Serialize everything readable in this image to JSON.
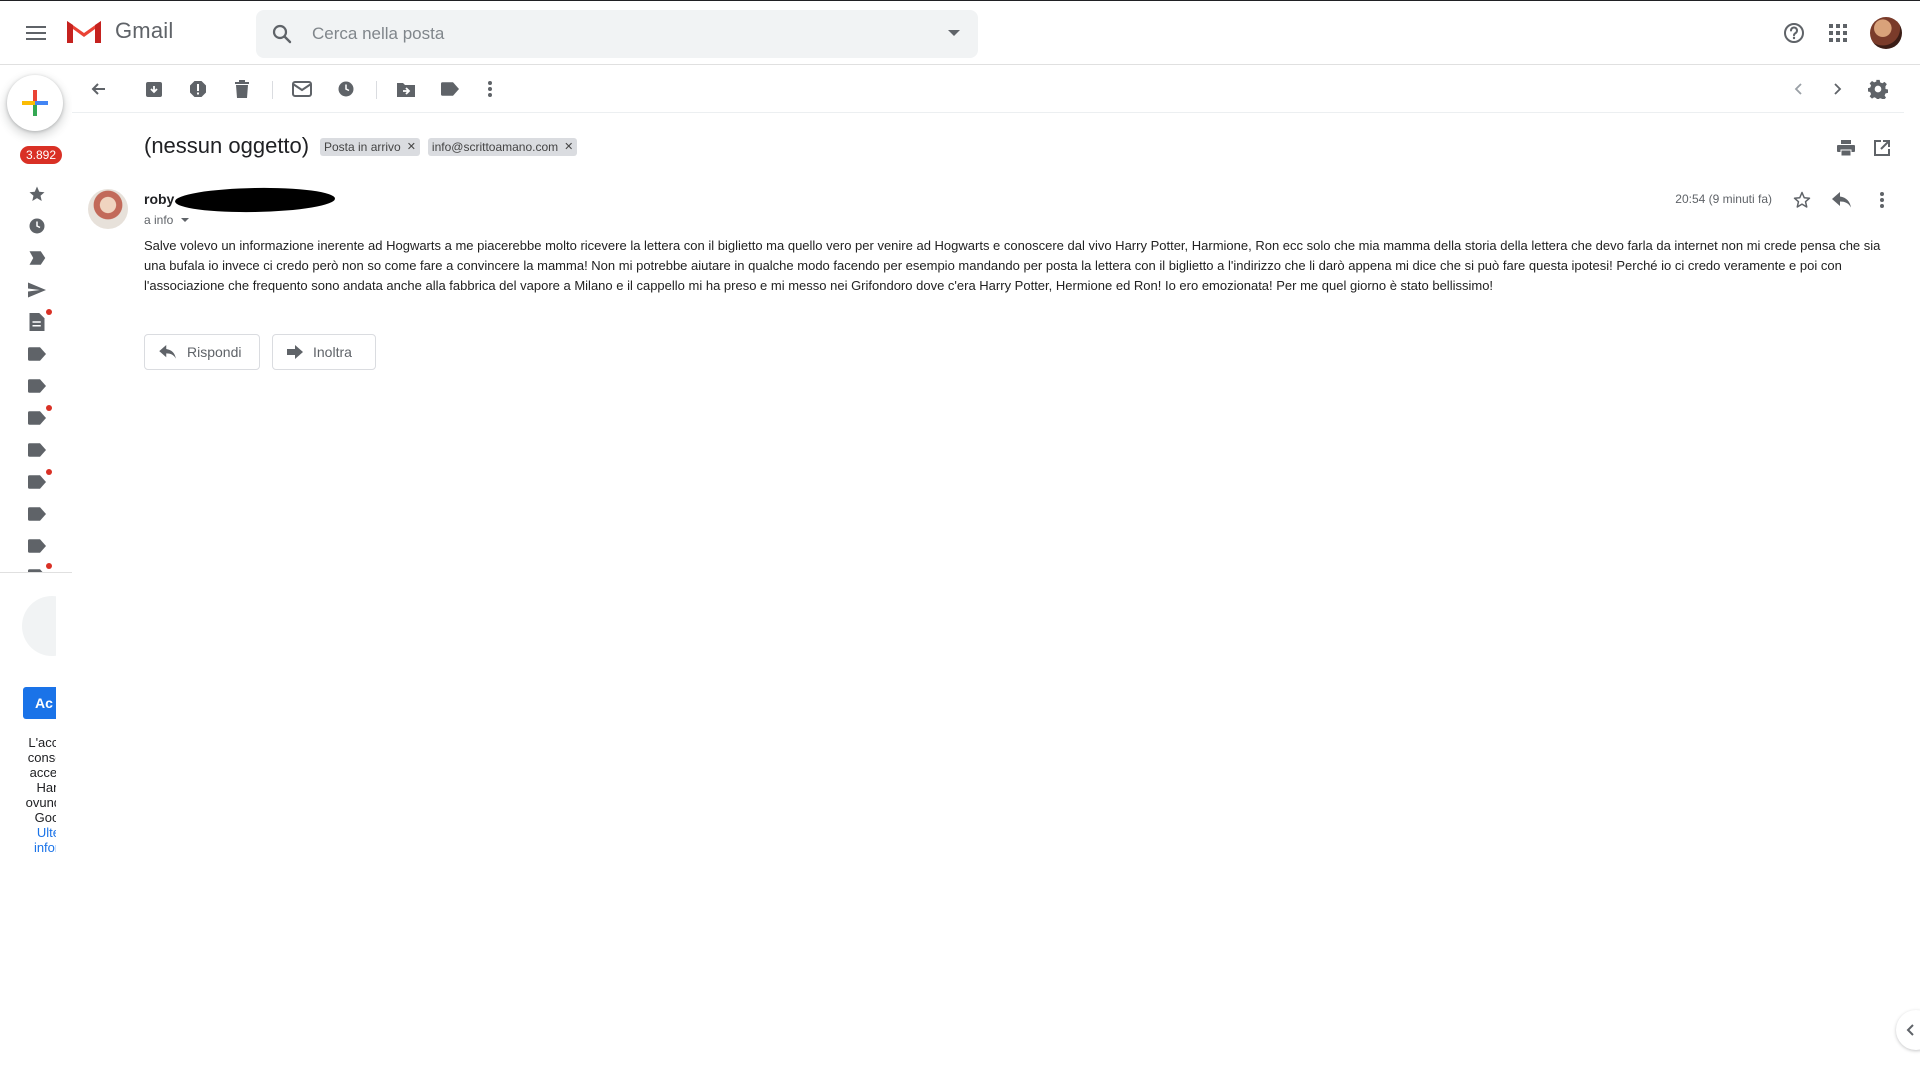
{
  "app": {
    "name": "Gmail"
  },
  "search": {
    "placeholder": "Cerca nella posta"
  },
  "sidebar": {
    "unread_badge": "3.892"
  },
  "message": {
    "subject": "(nessun oggetto)",
    "labels": [
      "Posta in arrivo",
      "info@scrittoamano.com"
    ],
    "sender_name": "roby",
    "to_line": "a info",
    "time": "20:54 (9 minuti fa)",
    "body": "Salve volevo un informazione inerente ad Hogwarts a me piacerebbe molto ricevere la lettera con il biglietto ma quello vero per venire ad Hogwarts e conoscere dal vivo Harry Potter, Harmione, Ron ecc solo che mia mamma della storia della lettera che devo farla da internet non mi crede pensa che sia una bufala io invece ci credo però non so come fare a convincere la mamma! Non mi potrebbe aiutare in qualche modo facendo per esempio mandando per posta la lettera con il biglietto a l'indirizzo che li darò appena mi dice che si può fare questa ipotesi! Perché io ci credo veramente e poi con l'associazione che frequento sono andata anche alla fabbrica del vapore a Milano e il cappello mi ha preso e mi messo nei Grifondoro dove c'era Harry Potter, Hermione ed Ron! Io ero emozionata! Per me quel giorno è stato bellissimo!",
    "reply_label": "Rispondi",
    "forward_label": "Inoltra"
  },
  "hangouts": {
    "button_label": "Ac",
    "text": "L'acce ti conse di accec a Hang ovunq su Googl",
    "link": "Ulteri inform"
  },
  "colors": {
    "accent": "#1a73e8",
    "badge": "#d93025",
    "chip": "#dadce0"
  }
}
